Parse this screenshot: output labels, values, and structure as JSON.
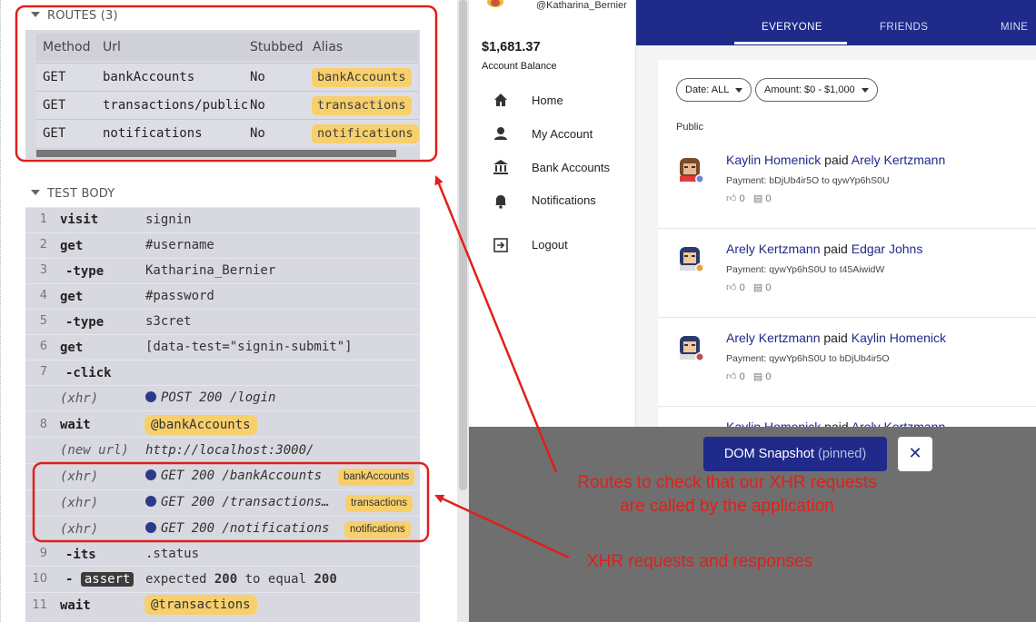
{
  "runner": {
    "routes_header": "ROUTES (3)",
    "routes_columns": [
      "Method",
      "Url",
      "Stubbed",
      "Alias"
    ],
    "routes": [
      {
        "method": "GET",
        "url": "bankAccounts",
        "stubbed": "No",
        "alias": "bankAccounts"
      },
      {
        "method": "GET",
        "url": "transactions/public",
        "stubbed": "No",
        "alias": "transactions"
      },
      {
        "method": "GET",
        "url": "notifications",
        "stubbed": "No",
        "alias": "notifications"
      }
    ],
    "test_body_header": "TEST BODY",
    "commands": {
      "c1": {
        "num": "1",
        "name": "visit",
        "msg": "signin"
      },
      "c2": {
        "num": "2",
        "name": "get",
        "msg": "#username"
      },
      "c3": {
        "num": "3",
        "name": "-type",
        "msg": "Katharina_Bernier"
      },
      "c4": {
        "num": "4",
        "name": "get",
        "msg": "#password"
      },
      "c5": {
        "num": "5",
        "name": "-type",
        "msg": "s3cret"
      },
      "c6": {
        "num": "6",
        "name": "get",
        "msg": "[data-test=\"signin-submit\"]"
      },
      "c7": {
        "num": "7",
        "name": "-click",
        "msg": ""
      },
      "x1": {
        "name": "(xhr)",
        "msg": "POST 200 /login"
      },
      "c8": {
        "num": "8",
        "name": "wait",
        "msg": "@bankAccounts"
      },
      "u1": {
        "name": "(new url)",
        "msg": "http://localhost:3000/"
      },
      "x2": {
        "name": "(xhr)",
        "msg": "GET 200 /bankAccounts",
        "alias": "bankAccounts"
      },
      "x3": {
        "name": "(xhr)",
        "msg": "GET 200 /transactions…",
        "alias": "transactions"
      },
      "x4": {
        "name": "(xhr)",
        "msg": "GET 200 /notifications",
        "alias": "notifications"
      },
      "c9": {
        "num": "9",
        "name": "-its",
        "msg": ".status"
      },
      "c10": {
        "num": "10",
        "name": "assert",
        "msg_a": "expected",
        "msg_b": "200",
        "msg_c": "to equal",
        "msg_d": "200"
      },
      "c11": {
        "num": "11",
        "name": "wait",
        "msg": "@transactions"
      }
    }
  },
  "app": {
    "username": "@Katharina_Bernier",
    "balance": "$1,681.37",
    "balance_label": "Account Balance",
    "nav": [
      "Home",
      "My Account",
      "Bank Accounts",
      "Notifications",
      "Logout"
    ],
    "tabs": [
      "EVERYONE",
      "FRIENDS",
      "MINE"
    ],
    "filters": {
      "date": "Date: ALL",
      "amount": "Amount: $0 - $1,000"
    },
    "section": "Public",
    "feed": [
      {
        "from": "Kaylin Homenick",
        "verb": "paid",
        "to": "Arely Kertzmann",
        "payment": "Payment: bDjUb4ir5O to qywYp6hS0U",
        "likes": "0",
        "comments": "0"
      },
      {
        "from": "Arely Kertzmann",
        "verb": "paid",
        "to": "Edgar Johns",
        "payment": "Payment: qywYp6hS0U to t45AiwidW",
        "likes": "0",
        "comments": "0"
      },
      {
        "from": "Arely Kertzmann",
        "verb": "paid",
        "to": "Kaylin Homenick",
        "payment": "Payment: qywYp6hS0U to bDjUb4ir5O",
        "likes": "0",
        "comments": "0"
      },
      {
        "from": "Kaylin Homenick",
        "verb": "paid",
        "to": "Arely Kertzmann"
      }
    ]
  },
  "snapshot": {
    "label": "DOM Snapshot",
    "pinned": "(pinned)",
    "close": "✕"
  },
  "annotations": {
    "routes_note_1": "Routes to check that our XHR requests",
    "routes_note_2": "are called by the application",
    "xhr_note": "XHR requests and responses"
  },
  "colors": {
    "accent": "#1f2a8a",
    "alias": "#f7cf6b",
    "annotation": "#e0201a"
  }
}
